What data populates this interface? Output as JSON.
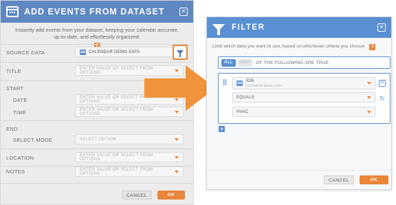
{
  "left_dialog": {
    "title": "ADD EVENTS FROM DATASET",
    "intro": "Instantly add events from your dataset, keeping your calendar accurate, up-to-date, and effortlessly organized.",
    "help": "?",
    "rows": {
      "source_label": "SOURCE DATA",
      "source_value": "CALENDAR DEMO DATA",
      "title_label": "TITLE",
      "title_placeholder": "ENTER VALUE OR SELECT FROM OPTIONS",
      "start_label": "START",
      "date_label": "DATE",
      "date_placeholder": "ENTER VALUE OR SELECT FROM OPTIONS",
      "time_label": "TIME",
      "time_placeholder": "ENTER VALUE OR SELECT FROM OPTIONS",
      "end_label": "END",
      "select_mode_label": "SELECT MODE",
      "select_mode_placeholder": "SELECT OPTION",
      "location_label": "LOCATION",
      "location_placeholder": "ENTER VALUE OR SELECT FROM OPTIONS",
      "notes_label": "NOTES",
      "notes_placeholder": "ENTER VALUE OR SELECT FROM OPTIONS"
    },
    "cancel_label": "CANCEL",
    "ok_label": "OK",
    "close": "✕"
  },
  "filter_dialog": {
    "title": "FILTER",
    "intro": "Limit which data you want to use, based on whichever criteria you choose.",
    "help": "?",
    "close": "✕",
    "match": {
      "all_label": "ALL",
      "any_label": "ANY",
      "suffix": "OF THE FOLLOWING ARE TRUE"
    },
    "condition": {
      "field": "JOB",
      "field_source": "CALENDAR DEMO DATA",
      "operator": "EQUALS",
      "value": "HVAC",
      "delete": "✕",
      "refresh": "↻"
    },
    "add": "+",
    "cancel_label": "CANCEL",
    "ok_label": "OK"
  },
  "colors": {
    "accent_orange": "#e8863a",
    "header_blue": "#5a8fd4",
    "header_blue_dim": "#5f88c3"
  },
  "icons": {
    "left_header": "calendar-icon",
    "filter_button": "funnel-icon",
    "filter_header": "funnel-icon",
    "source_field": "database-icon",
    "condition_field": "database-icon",
    "drag": "drag-handle-icon"
  }
}
